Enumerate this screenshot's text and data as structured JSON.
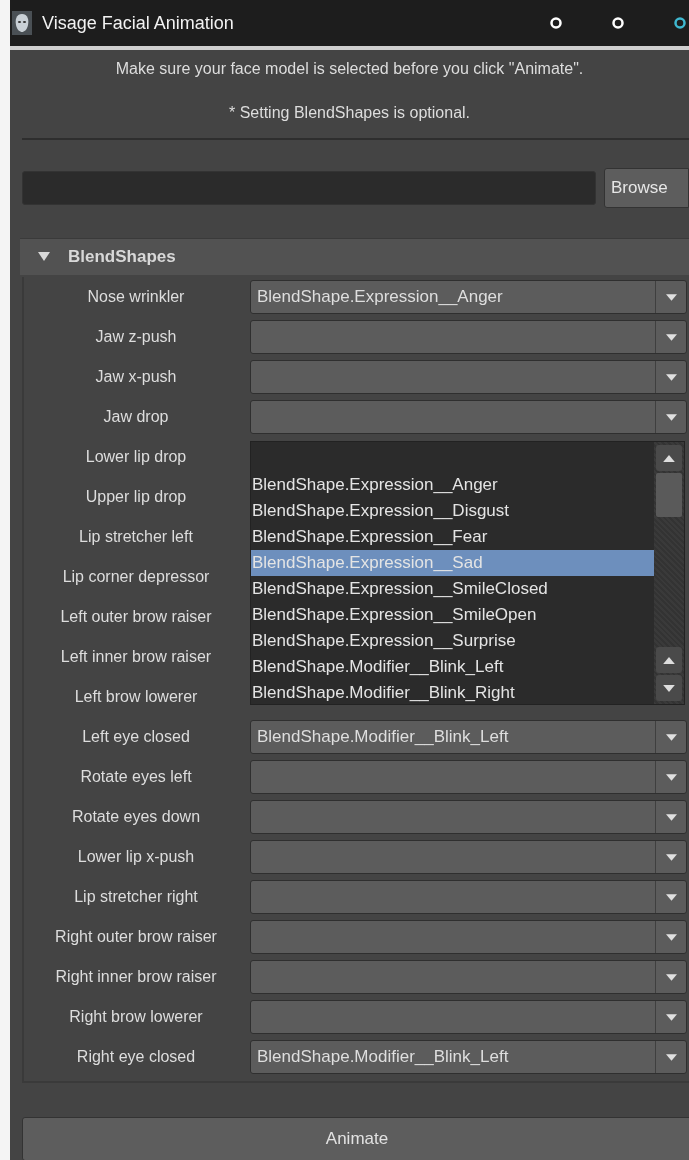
{
  "window": {
    "title": "Visage Facial Animation",
    "buttons": [
      {
        "color": "#ffffff"
      },
      {
        "color": "#ffffff"
      },
      {
        "color": "#3fb8d0"
      }
    ]
  },
  "intro": [
    "Make sure your face model is selected before you click \"Animate\".",
    "* Setting BlendShapes is optional."
  ],
  "file_row": {
    "button": "Browse"
  },
  "section": {
    "title": "BlendShapes",
    "expanded": true
  },
  "rows": [
    {
      "label": "Nose wrinkler",
      "value": "BlendShape.Expression__Anger",
      "covered": false
    },
    {
      "label": "Jaw z-push",
      "covered": false
    },
    {
      "label": "Jaw x-push",
      "covered": false
    },
    {
      "label": "Jaw drop",
      "covered": false
    },
    {
      "label": "Lower lip drop",
      "covered": true
    },
    {
      "label": "Upper lip drop",
      "covered": true
    },
    {
      "label": "Lip stretcher left",
      "covered": true
    },
    {
      "label": "Lip corner depressor",
      "covered": true
    },
    {
      "label": "Left outer brow raiser",
      "covered": true
    },
    {
      "label": "Left inner brow raiser",
      "covered": true
    },
    {
      "label": "Left brow lowerer",
      "covered": true
    },
    {
      "label": "Left eye closed",
      "value": "BlendShape.Modifier__Blink_Left",
      "covered": false
    },
    {
      "label": "Rotate eyes left",
      "covered": false
    },
    {
      "label": "Rotate eyes down",
      "covered": false
    },
    {
      "label": "Lower lip x-push",
      "covered": false
    },
    {
      "label": "Lip stretcher right",
      "covered": false
    },
    {
      "label": "Right outer brow raiser",
      "covered": false
    },
    {
      "label": "Right inner brow raiser",
      "covered": false
    },
    {
      "label": "Right brow lowerer",
      "covered": false
    },
    {
      "label": "Right eye closed",
      "value": "BlendShape.Modifier__Blink_Left",
      "covered": false
    }
  ],
  "dropdown_list": {
    "items": [
      {
        "label": "BlendShape.Expression__Anger",
        "selected": false
      },
      {
        "label": "BlendShape.Expression__Disgust",
        "selected": false
      },
      {
        "label": "BlendShape.Expression__Fear",
        "selected": false
      },
      {
        "label": "BlendShape.Expression__Sad",
        "selected": true
      },
      {
        "label": "BlendShape.Expression__SmileClosed",
        "selected": false
      },
      {
        "label": "BlendShape.Expression__SmileOpen",
        "selected": false
      },
      {
        "label": "BlendShape.Expression__Surprise",
        "selected": false
      },
      {
        "label": "BlendShape.Modifier__Blink_Left",
        "selected": false
      },
      {
        "label": "BlendShape.Modifier__Blink_Right",
        "selected": false
      }
    ]
  },
  "animate_button": "Animate"
}
